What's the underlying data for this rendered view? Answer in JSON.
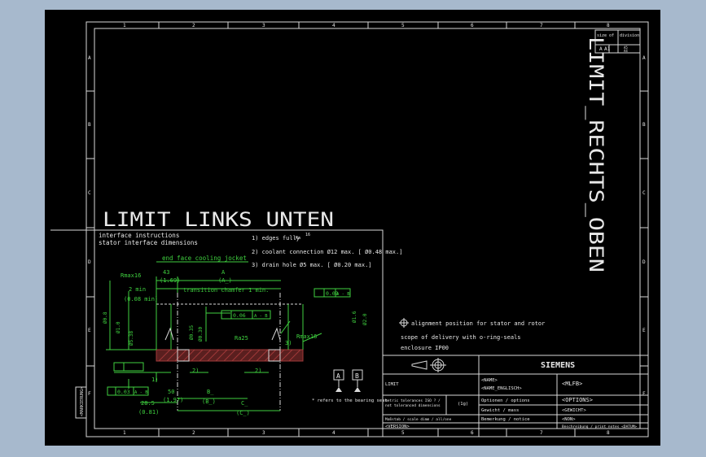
{
  "colors": {
    "background_outer": "#a7b9cd",
    "sheet": "#000000",
    "frame": "#d8d8d8",
    "dim": "#3fd13f",
    "hatch": "#a03a3a",
    "text": "#e8e8e8"
  },
  "zone_cols": [
    "1",
    "2",
    "3",
    "4",
    "5",
    "6",
    "7",
    "8"
  ],
  "zone_rows": [
    "A",
    "B",
    "C",
    "D",
    "E",
    "F"
  ],
  "titles": {
    "left_limit": "LIMIT_LINKS_UNTEN",
    "right_limit": "LIMIT_RECHTS_OBEN"
  },
  "top_right_box": {
    "size": "size of\nDSMB",
    "division": "division",
    "a_label": "A",
    "a_value": "A1",
    "sub": "A5",
    "sub2": "A4"
  },
  "notes": {
    "line1": "interface instructions",
    "line2": "stator interface dimensions",
    "n1": "1) edges fully",
    "n1_ra": "Ra",
    "n1_val": "16",
    "n2": "2) coolant connection Ø12 max. [ Ø0.48 max.]",
    "n3": "3) drain hole Ø5 max.  [ Ø0.20 max.]",
    "cooling": "end face cooling jocket"
  },
  "dims": {
    "d43": "43",
    "d169": "(1.69)",
    "A": "A",
    "A_paren": "(A_)",
    "rmax": "Rmax16",
    "twomin": "2 min",
    "d008": "(0.08 min)",
    "trans": "transition chamfer  1 min.",
    "tol1_val": "0.03",
    "tol1_ref": "A - B",
    "tol2_val": "0.06",
    "tol2_ref": "A - B",
    "tol3_val": "0.03",
    "tol3_ref": "A - B",
    "ra25": "Ra25",
    "rmax16b": "Rmax16",
    "three": "3)",
    "two": "2)",
    "one": "1)",
    "d50": "50",
    "d197": "(1.97)",
    "B": "B_",
    "Bp": "(B_)",
    "d285": "28.5",
    "d081": "(0.81)",
    "C": "C_",
    "Cp": "(C_)",
    "Alabel": "A",
    "Blabel": "B",
    "refnote": "* refers to the bearing seat"
  },
  "right_notes": {
    "alignment": "alignment position for stator and rotor",
    "scope": "scope of delivery with o-ring-seals",
    "enclosure": "enclosure IP00"
  },
  "title_block": {
    "brand": "SIEMENS",
    "name": "<NAME>",
    "name_en": "<NAME_ENGLISCH>",
    "mlfb": "<MLFB>",
    "limit": "LIMIT",
    "tolerance": "metric tolerances ISO ? /\nnot toleranced dimensions",
    "tol_val": "(1g)",
    "options_label": "Optionen / options",
    "options_value": "<OPTIONS>",
    "weight_label": "Gewicht / mass",
    "weight_value": "<GEWICHT>",
    "remark_label": "Bemerkung / notice",
    "remark_value": "<NON>",
    "version": "<VERSION>",
    "massstab": "Maßstab / scale  dimm / all/one",
    "description": "Beschreibung / print notes <DATUM>"
  },
  "side_stamp": "<MARKIERUNG>"
}
